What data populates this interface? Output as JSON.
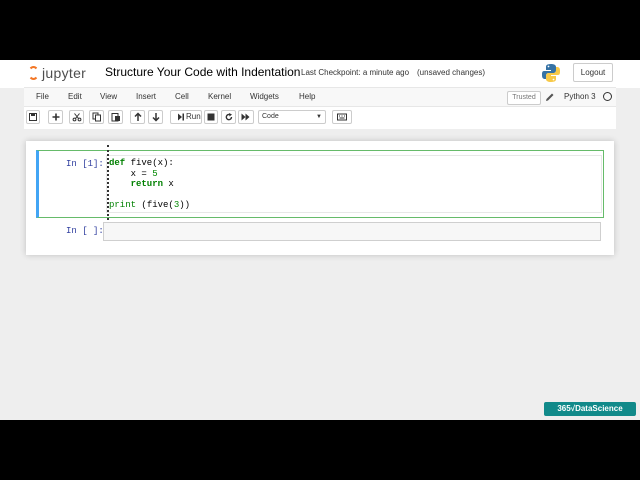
{
  "header": {
    "logo_text": "jupyter",
    "title": "Structure Your Code with Indentation",
    "checkpoint": "Last Checkpoint: a minute ago",
    "save_status": "(unsaved changes)",
    "logout_label": "Logout"
  },
  "menubar": {
    "items": [
      "File",
      "Edit",
      "View",
      "Insert",
      "Cell",
      "Kernel",
      "Widgets",
      "Help"
    ],
    "trusted_label": "Trusted",
    "kernel_name": "Python 3"
  },
  "toolbar": {
    "run_label": "Run",
    "cell_type": "Code"
  },
  "cells": [
    {
      "prompt": "In [1]:",
      "code": {
        "line1_kw": "def",
        "line1_rest": " five(x):",
        "line2": "    x = ",
        "line2_num": "5",
        "line3_kw": "return",
        "line3_rest": " x",
        "line5_fn": "print",
        "line5_rest": " (five(",
        "line5_num": "3",
        "line5_end": "))"
      }
    },
    {
      "prompt": "In [ ]:"
    }
  ],
  "watermark": "365√DataScience",
  "colors": {
    "jupyter_orange": "#f37726",
    "selected_border": "#66bb6a",
    "edit_bar": "#42a5f5",
    "prompt": "#303f9f",
    "keyword": "#008000",
    "watermark_bg": "#118a8a"
  }
}
